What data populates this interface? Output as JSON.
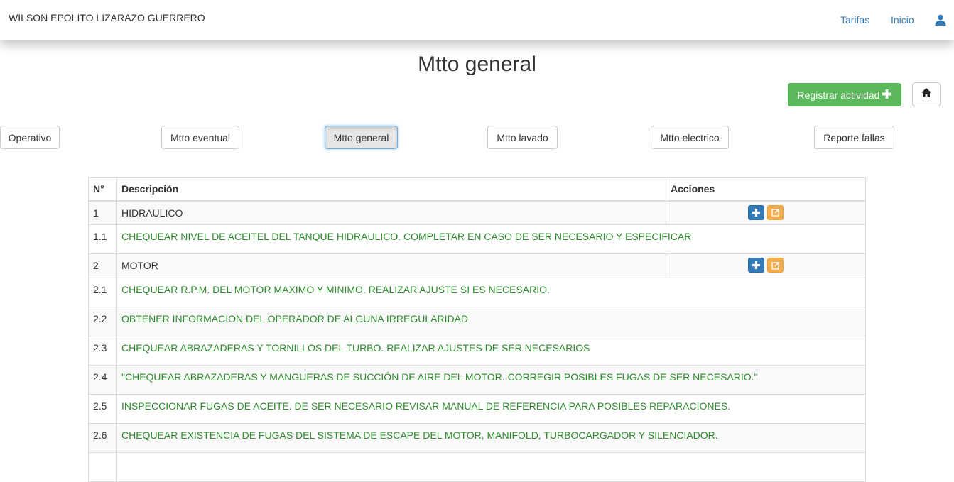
{
  "navbar": {
    "brand": "WILSON EPOLITO LIZARAZO GUERRERO",
    "links": [
      "Tarifas",
      "Inicio"
    ],
    "user_icon": "user-icon"
  },
  "page": {
    "title": "Mtto general",
    "register_button": "Registrar actividad",
    "register_icon": "plus-icon",
    "home_icon": "home-icon"
  },
  "tabs": [
    {
      "label": "Operativo",
      "active": false
    },
    {
      "label": "Mtto eventual",
      "active": false
    },
    {
      "label": "Mtto general",
      "active": true
    },
    {
      "label": "Mtto lavado",
      "active": false
    },
    {
      "label": "Mtto electrico",
      "active": false
    },
    {
      "label": "Reporte fallas",
      "active": false
    }
  ],
  "table": {
    "headers": [
      "N°",
      "Descripción",
      "Acciones"
    ],
    "rows": [
      {
        "n": "1",
        "desc": "HIDRAULICO",
        "type": "category"
      },
      {
        "n": "1.1",
        "desc": "CHEQUEAR NIVEL DE ACEITEL DEL TANQUE HIDRAULICO. COMPLETAR EN CASO DE SER NECESARIO Y ESPECIFICAR",
        "type": "item"
      },
      {
        "n": "2",
        "desc": "MOTOR",
        "type": "category"
      },
      {
        "n": "2.1",
        "desc": "CHEQUEAR R.P.M. DEL MOTOR MAXIMO Y MINIMO. REALIZAR AJUSTE SI ES NECESARIO.",
        "type": "item"
      },
      {
        "n": "2.2",
        "desc": "OBTENER INFORMACION DEL OPERADOR DE ALGUNA IRREGULARIDAD",
        "type": "item"
      },
      {
        "n": "2.3",
        "desc": "CHEQUEAR ABRAZADERAS Y TORNILLOS DEL TURBO. REALIZAR AJUSTES DE SER NECESARIOS",
        "type": "item"
      },
      {
        "n": "2.4",
        "desc": "\"CHEQUEAR ABRAZADERAS Y MANGUERAS DE SUCCIÓN DE AIRE DEL MOTOR. CORREGIR POSIBLES FUGAS DE SER NECESARIO.\"",
        "type": "item"
      },
      {
        "n": "2.5",
        "desc": "INSPECCIONAR FUGAS DE ACEITE. DE SER NECESARIO REVISAR MANUAL DE REFERENCIA PARA POSIBLES REPARACIONES.",
        "type": "item"
      },
      {
        "n": "2.6",
        "desc": "CHEQUEAR EXISTENCIA DE FUGAS DEL SISTEMA DE ESCAPE DEL MOTOR, MANIFOLD, TURBOCARGADOR Y SILENCIADOR.",
        "type": "item"
      },
      {
        "n": "",
        "desc": "",
        "type": "item"
      }
    ]
  },
  "colors": {
    "link": "#337ab7",
    "success": "#5cb85c",
    "primary": "#337ab7",
    "warning": "#f0ad4e",
    "item_text": "#2e8b2e"
  }
}
